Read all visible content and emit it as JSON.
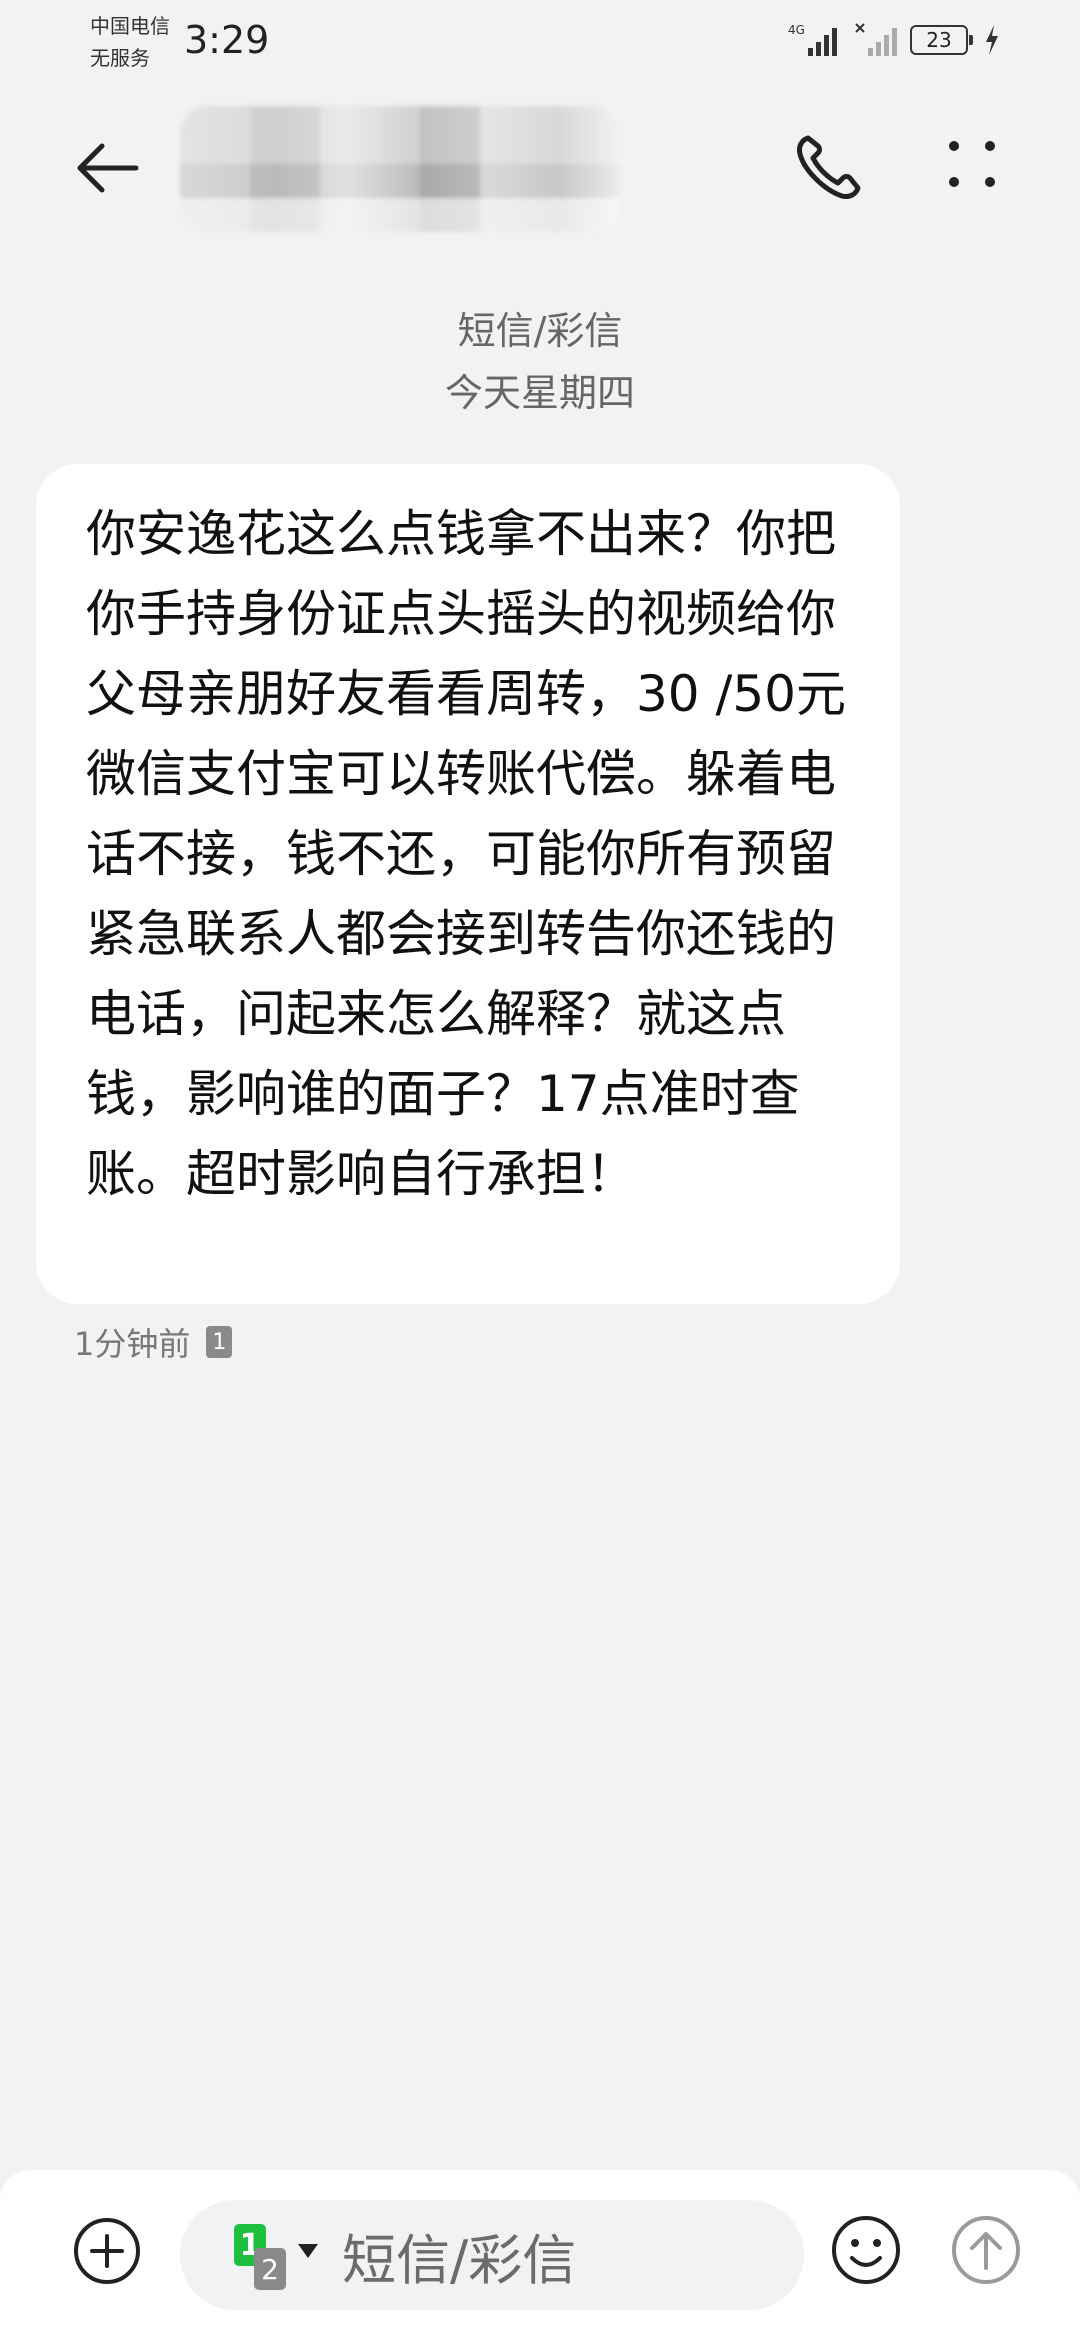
{
  "status_bar": {
    "carrier": "中国电信",
    "service": "无服务",
    "time": "3:29",
    "network": "4G",
    "battery": "23"
  },
  "header": {
    "back_icon": "arrow-left-icon",
    "call_icon": "phone-icon",
    "more_icon": "more-dots-icon"
  },
  "conversation": {
    "channel": "短信/彩信",
    "day": "今天星期四"
  },
  "message": {
    "text": "你安逸花这么点钱拿不出来？你把你手持身份证点头摇头的视频给你父母亲朋好友看看周转，30 /50元微信支付宝可以转账代偿。躲着电话不接，钱不还，可能你所有预留紧急联系人都会接到转告你还钱的电话，问起来怎么解释？就这点钱，影响谁的面子？17点准时查账。超时影响自行承担！",
    "time_ago": "1分钟前",
    "sim": "1"
  },
  "input_bar": {
    "add_icon": "plus-circle-icon",
    "sim1": "1",
    "sim2": "2",
    "placeholder": "短信/彩信",
    "emoji_icon": "smiley-icon",
    "send_icon": "send-arrow-icon"
  },
  "colors": {
    "background": "#f1f2f4",
    "bubble": "#ffffff",
    "sim1": "#1fbf3f",
    "muted_text": "#666666"
  }
}
